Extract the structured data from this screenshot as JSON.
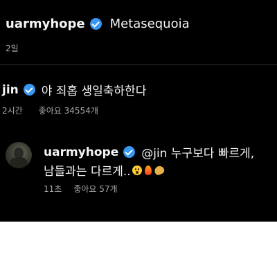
{
  "post": {
    "author": "uarmyhope",
    "caption": "Metasequoia",
    "time": "2일"
  },
  "comments": [
    {
      "author": "jin",
      "text": "야 죄홉 생일축하한다",
      "time": "2시간",
      "likes": "좋아요 34554개"
    }
  ],
  "reply": {
    "author": "uarmyhope",
    "text_line1": "@jin 누구보다 빠르게,",
    "text_line2": "남들과는 다르게..",
    "emojis": [
      "astonished-face",
      "fire",
      "clapping-hands"
    ],
    "time": "11초",
    "likes": "좋아요 57개"
  },
  "colors": {
    "background": "#000000",
    "text": "#f5f5f5",
    "muted": "#a8a8a8",
    "verified": "#3897f0"
  }
}
